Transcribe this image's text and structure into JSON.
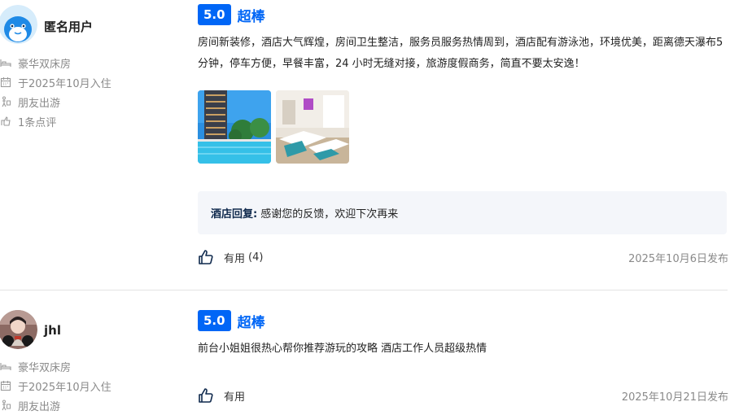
{
  "reviews": [
    {
      "user": {
        "name": "匿名用户",
        "avatar_icon": "dolphin-avatar-icon"
      },
      "meta": [
        {
          "icon": "bed-icon",
          "text": "豪华双床房"
        },
        {
          "icon": "calendar-icon",
          "text": "于2025年10月入住"
        },
        {
          "icon": "travel-type-icon",
          "text": "朋友出游"
        },
        {
          "icon": "review-count-icon",
          "text": "1条点评"
        }
      ],
      "score": "5.0",
      "score_label": "超棒",
      "text": "房间新装修，酒店大气辉煌，房间卫生整洁，服务员服务热情周到，酒店配有游泳池，环境优美，距离德天瀑布5 分钟，停车方便，早餐丰富，24 小时无缝对接，旅游度假商务，简直不要太安逸！",
      "photos": [
        "hotel-pool-photo",
        "twin-room-photo"
      ],
      "reply": {
        "label": "酒店回复:",
        "text": "感谢您的反馈，欢迎下次再来"
      },
      "helpful": {
        "label": "有用",
        "count": "(4)"
      },
      "date": "2025年10月6日发布"
    },
    {
      "user": {
        "name": "jhl⁠",
        "avatar_icon": "user-photo-avatar-icon"
      },
      "meta": [
        {
          "icon": "bed-icon",
          "text": "豪华双床房"
        },
        {
          "icon": "calendar-icon",
          "text": "于2025年10月入住"
        },
        {
          "icon": "travel-type-icon",
          "text": "朋友出游"
        }
      ],
      "score": "5.0",
      "score_label": "超棒",
      "text": "前台小姐姐很热心帮你推荐游玩的攻略 酒店工作人员超级热情",
      "helpful": {
        "label": "有用",
        "count": ""
      },
      "date": "2025年10月21日发布"
    }
  ],
  "colors": {
    "accent": "#0066f6",
    "reply_bg": "#f4f6fa",
    "muted": "#8a8a8a"
  }
}
